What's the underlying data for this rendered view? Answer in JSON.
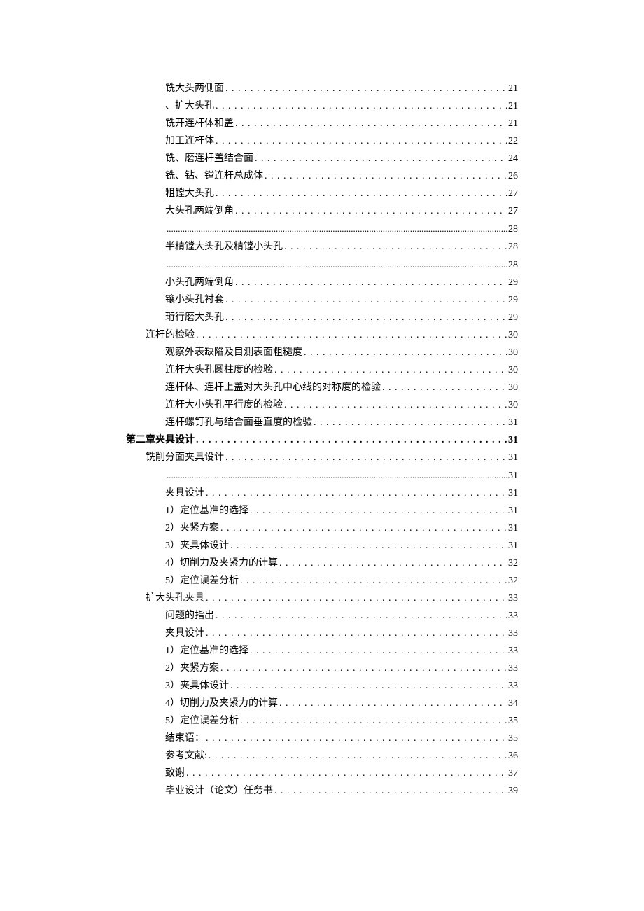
{
  "toc": [
    {
      "label": "铣大头两侧面",
      "page": "21",
      "indent": 2,
      "bold": false,
      "tight": false
    },
    {
      "label": "、扩大头孔",
      "page": "21",
      "indent": 2,
      "bold": false,
      "tight": false
    },
    {
      "label": "铣开连杆体和盖",
      "page": "21",
      "indent": 2,
      "bold": false,
      "tight": false
    },
    {
      "label": "加工连杆体",
      "page": "22",
      "indent": 2,
      "bold": false,
      "tight": false
    },
    {
      "label": "铣、磨连杆盖结合面",
      "page": "24",
      "indent": 2,
      "bold": false,
      "tight": false
    },
    {
      "label": "铣、钻、镗连杆总成体",
      "page": "26",
      "indent": 2,
      "bold": false,
      "tight": false
    },
    {
      "label": "粗镗大头孔",
      "page": "27",
      "indent": 2,
      "bold": false,
      "tight": false
    },
    {
      "label": "大头孔两端倒角",
      "page": "27",
      "indent": 2,
      "bold": false,
      "tight": false
    },
    {
      "label": "",
      "page": "28",
      "indent": 2,
      "bold": false,
      "tight": true
    },
    {
      "label": "半精镗大头孔及精镗小头孔",
      "page": "28",
      "indent": 2,
      "bold": false,
      "tight": false
    },
    {
      "label": "",
      "page": "28",
      "indent": 2,
      "bold": false,
      "tight": true
    },
    {
      "label": "小头孔两端倒角",
      "page": "29",
      "indent": 2,
      "bold": false,
      "tight": false
    },
    {
      "label": "镶小头孔衬套",
      "page": "29",
      "indent": 2,
      "bold": false,
      "tight": false
    },
    {
      "label": "珩行磨大头孔",
      "page": "29",
      "indent": 2,
      "bold": false,
      "tight": false
    },
    {
      "label": "连杆的检验",
      "page": "30",
      "indent": 1,
      "bold": false,
      "tight": false
    },
    {
      "label": "观察外表缺陷及目测表面粗糙度",
      "page": "30",
      "indent": 2,
      "bold": false,
      "tight": false
    },
    {
      "label": "连杆大头孔圆柱度的检验",
      "page": "30",
      "indent": 2,
      "bold": false,
      "tight": false
    },
    {
      "label": "连杆体、连杆上盖对大头孔中心线的对称度的检验",
      "page": "30",
      "indent": 2,
      "bold": false,
      "tight": false
    },
    {
      "label": "连杆大小头孔平行度的检验",
      "page": "30",
      "indent": 2,
      "bold": false,
      "tight": false
    },
    {
      "label": "连杆螺钉孔与结合面垂直度的检验",
      "page": "31",
      "indent": 2,
      "bold": false,
      "tight": false
    },
    {
      "label": "第二章夹具设计",
      "page": "31",
      "indent": 0,
      "bold": true,
      "tight": false
    },
    {
      "label": "铣削分面夹具设计",
      "page": "31",
      "indent": 1,
      "bold": false,
      "tight": false
    },
    {
      "label": "",
      "page": "31",
      "indent": 2,
      "bold": false,
      "tight": true
    },
    {
      "label": "夹具设计",
      "page": "31",
      "indent": 2,
      "bold": false,
      "tight": false
    },
    {
      "label": "1）定位基准的选择",
      "page": "31",
      "indent": 2,
      "bold": false,
      "tight": false
    },
    {
      "label": "2）夹紧方案",
      "page": "31",
      "indent": 2,
      "bold": false,
      "tight": false
    },
    {
      "label": "3）夹具体设计",
      "page": "31",
      "indent": 2,
      "bold": false,
      "tight": false
    },
    {
      "label": "4）切削力及夹紧力的计算",
      "page": "32",
      "indent": 2,
      "bold": false,
      "tight": false
    },
    {
      "label": "5）定位误差分析",
      "page": "32",
      "indent": 2,
      "bold": false,
      "tight": false
    },
    {
      "label": "扩大头孔夹具",
      "page": "33",
      "indent": 1,
      "bold": false,
      "tight": false
    },
    {
      "label": "问题的指出",
      "page": "33",
      "indent": 2,
      "bold": false,
      "tight": false
    },
    {
      "label": "夹具设计",
      "page": "33",
      "indent": 2,
      "bold": false,
      "tight": false
    },
    {
      "label": "1）定位基准的选择",
      "page": "33",
      "indent": 2,
      "bold": false,
      "tight": false
    },
    {
      "label": "2）夹紧方案",
      "page": "33",
      "indent": 2,
      "bold": false,
      "tight": false
    },
    {
      "label": "3）夹具体设计",
      "page": "33",
      "indent": 2,
      "bold": false,
      "tight": false
    },
    {
      "label": "4）切削力及夹紧力的计算",
      "page": "34",
      "indent": 2,
      "bold": false,
      "tight": false
    },
    {
      "label": "5）定位误差分析",
      "page": "35",
      "indent": 2,
      "bold": false,
      "tight": false
    },
    {
      "label": "结束语：",
      "page": "35",
      "indent": 2,
      "bold": false,
      "tight": false
    },
    {
      "label": "参考文献:",
      "page": "36",
      "indent": 2,
      "bold": false,
      "tight": false
    },
    {
      "label": "致谢",
      "page": "37",
      "indent": 2,
      "bold": false,
      "tight": false
    },
    {
      "label": "毕业设计（论文）任务书",
      "page": "39",
      "indent": 2,
      "bold": false,
      "tight": false
    }
  ]
}
